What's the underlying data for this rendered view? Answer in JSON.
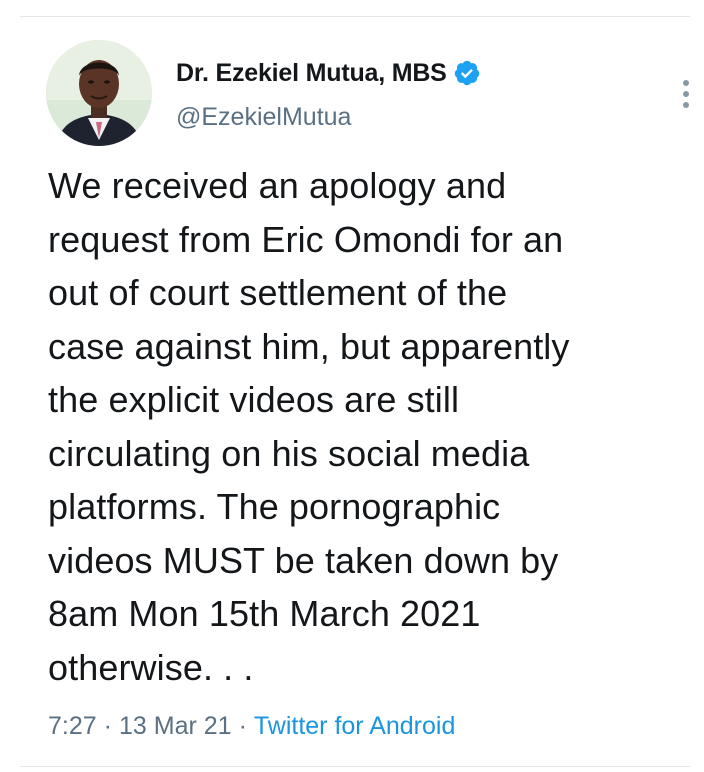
{
  "tweet": {
    "author": {
      "display_name": "Dr. Ezekiel Mutua, MBS",
      "handle": "@EzekielMutua",
      "verified": true,
      "avatar_icon": "profile-photo"
    },
    "text": "We received an apology and\nrequest from Eric Omondi for an\nout of court settlement of the\ncase against him, but apparently\nthe explicit videos are still\ncirculating on his social media\nplatforms. The pornographic\nvideos MUST be taken down by\n8am Mon 15th March 2021\notherwise. . .",
    "time": "7:27",
    "separator": "·",
    "date": "13 Mar 21",
    "source": "Twitter for Android"
  },
  "icons": {
    "verified": "verified-badge-icon",
    "more": "more-vertical-icon"
  },
  "colors": {
    "text": "#14171a",
    "muted": "#5b7083",
    "link": "#1b95e0",
    "verified": "#1da1f2"
  }
}
